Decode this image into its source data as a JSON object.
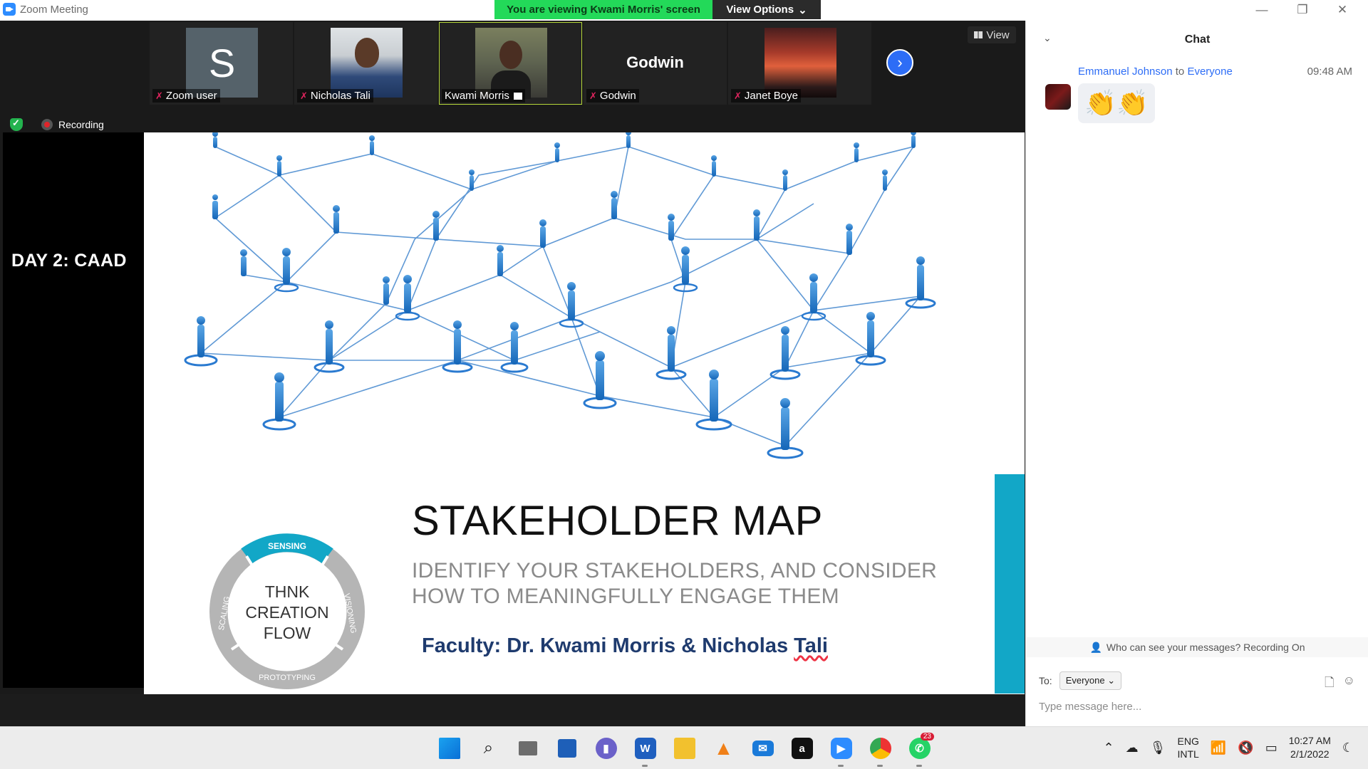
{
  "window": {
    "title": "Zoom Meeting",
    "viewing_banner": "You are viewing Kwami Morris' screen",
    "view_options": "View Options"
  },
  "participants": [
    {
      "name": "Zoom user",
      "avatar_letter": "S"
    },
    {
      "name": "Nicholas Tali"
    },
    {
      "name": "Kwami Morris"
    },
    {
      "name": "Godwin",
      "big_name": "Godwin"
    },
    {
      "name": "Janet Boye"
    }
  ],
  "view_button": "View",
  "recording_label": "Recording",
  "shared_screen": {
    "day_label": "DAY 2: CAAD",
    "slide": {
      "title": "STAKEHOLDER MAP",
      "subtitle_line1": "IDENTIFY YOUR STAKEHOLDERS, AND CONSIDER",
      "subtitle_line2": "HOW TO MEANINGFULLY ENGAGE THEM",
      "faculty_prefix": "Faculty: Dr. Kwami Morris & Nicholas ",
      "faculty_last": "Tali",
      "cycle": {
        "center_lines": [
          "THNK",
          "CREATION",
          "FLOW"
        ],
        "segments": [
          "SENSING",
          "VISIONING",
          "PROTOTYPING",
          "SCALING"
        ]
      }
    }
  },
  "chat": {
    "title": "Chat",
    "messages": [
      {
        "sender": "Emmanuel Johnson",
        "to_word": "to",
        "recipient": "Everyone",
        "time": "09:48 AM",
        "content": "👏👏"
      }
    ],
    "privacy_notice": "Who can see your messages? Recording On",
    "to_label": "To:",
    "to_value": "Everyone",
    "input_placeholder": "Type message here..."
  },
  "taskbar": {
    "apps": [
      "start",
      "search",
      "task-view",
      "widgets",
      "teams-chat",
      "word",
      "file-explorer",
      "vlc",
      "mail",
      "amazon",
      "zoom",
      "chrome",
      "whatsapp"
    ],
    "whatsapp_badge": "23",
    "lang_line1": "ENG",
    "lang_line2": "INTL",
    "time": "10:27 AM",
    "date": "2/1/2022"
  },
  "colors": {
    "banner_green": "#23d959",
    "accent_blue": "#2d6df6",
    "slide_teal": "#12a7c7",
    "faculty_navy": "#1f3b6e"
  }
}
